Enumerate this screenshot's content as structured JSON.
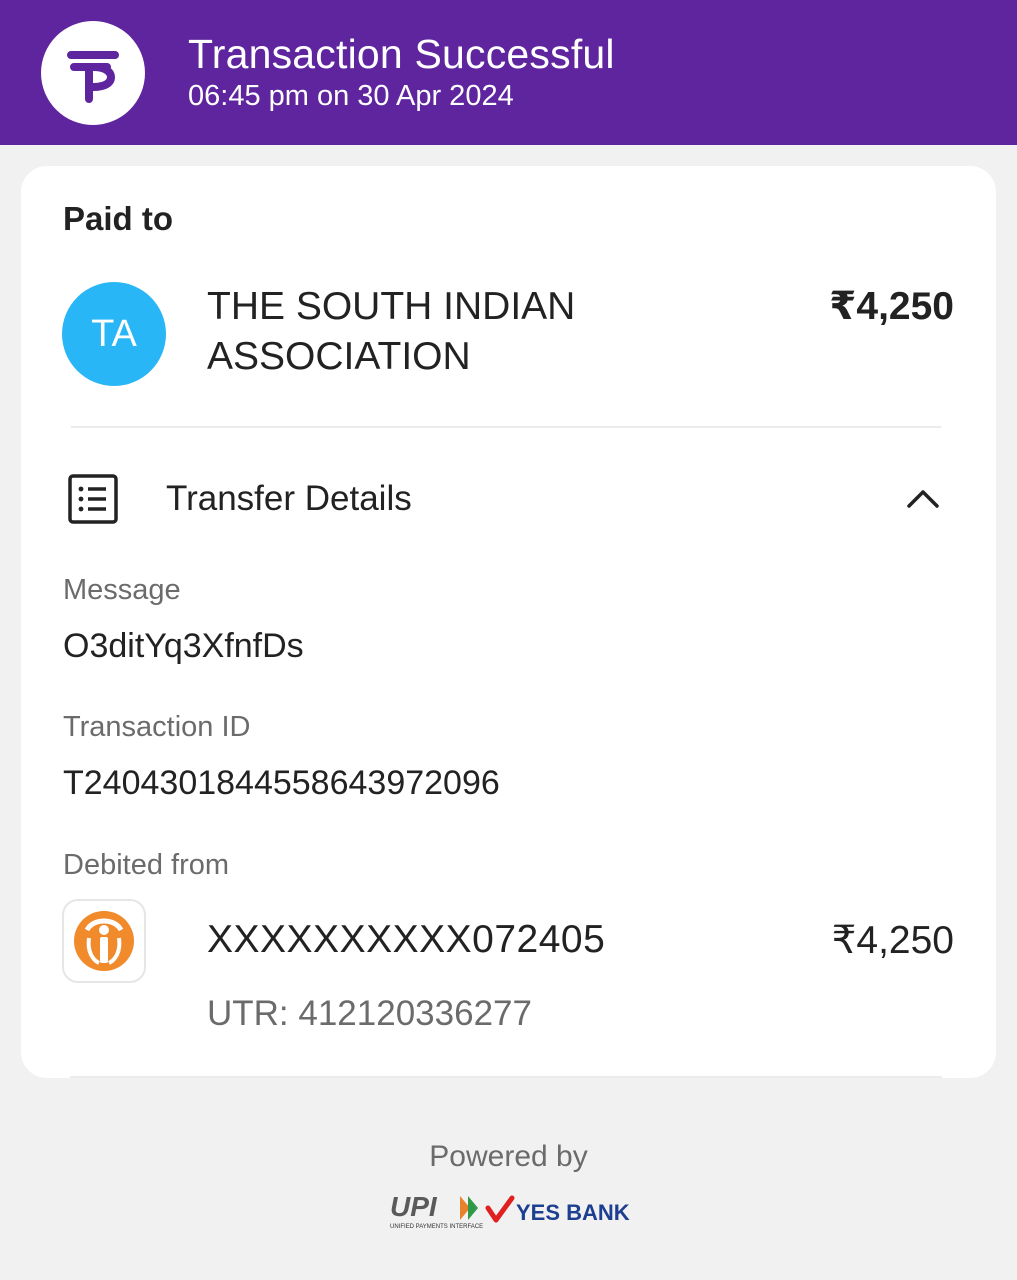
{
  "header": {
    "status": "Transaction Successful",
    "timestamp": "06:45 pm on 30 Apr 2024",
    "logo_icon": "phonepe-logo-icon",
    "brand_color": "#5f259f"
  },
  "payee": {
    "section_label": "Paid to",
    "initials": "TA",
    "name_line1": "THE SOUTH INDIAN",
    "name_line2": "ASSOCIATION",
    "amount": "₹4,250",
    "avatar_color": "#29b6f6"
  },
  "transfer_details": {
    "label": "Transfer Details",
    "icon": "receipt-list-icon",
    "toggle_icon": "chevron-up-icon",
    "message_label": "Message",
    "message_value": "O3ditYq3XfnfDs",
    "transaction_id_label": "Transaction ID",
    "transaction_id_value": "T2404301844558643972096",
    "debited_from_label": "Debited from",
    "account_number": "XXXXXXXXXX072405",
    "debit_amount": "₹4,250",
    "utr": "UTR: 412120336277",
    "bank_icon": "idbi-bank-logo-icon",
    "bank_color": "#f08a2b"
  },
  "footer": {
    "powered_by": "Powered by",
    "upi_text": "UPI",
    "upi_subtext": "UNIFIED PAYMENTS INTERFACE",
    "bank_name": "YES BANK"
  }
}
